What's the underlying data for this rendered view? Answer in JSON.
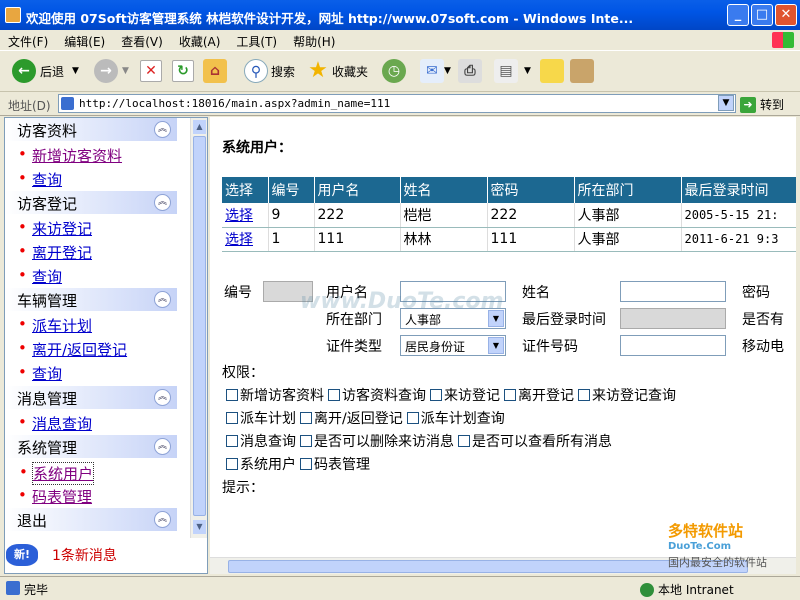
{
  "window": {
    "title": "欢迎使用 07Soft访客管理系统   林桤软件设计开发，网址 http://www.07soft.com - Windows Inte..."
  },
  "menu": [
    "文件(F)",
    "编辑(E)",
    "查看(V)",
    "收藏(A)",
    "工具(T)",
    "帮助(H)"
  ],
  "toolbar": {
    "back": "后退",
    "search": "搜索",
    "favorites": "收藏夹"
  },
  "address": {
    "label": "地址(D)",
    "url": "http://localhost:18016/main.aspx?admin_name=111",
    "go": "转到"
  },
  "sidebar": {
    "groups": [
      {
        "title": "访客资料",
        "items": [
          "新增访客资料",
          "查询"
        ]
      },
      {
        "title": "访客登记",
        "items": [
          "来访登记",
          "离开登记",
          "查询"
        ]
      },
      {
        "title": "车辆管理",
        "items": [
          "派车计划",
          "离开/返回登记",
          "查询"
        ]
      },
      {
        "title": "消息管理",
        "items": [
          "消息查询"
        ]
      },
      {
        "title": "系统管理",
        "items": [
          "系统用户",
          "码表管理"
        ]
      },
      {
        "title": "退出",
        "items": []
      }
    ],
    "new_message_badge": "新!",
    "new_message": "1条新消息"
  },
  "main": {
    "title": "系统用户：",
    "table": {
      "headers": [
        "选择",
        "编号",
        "用户名",
        "姓名",
        "密码",
        "所在部门",
        "最后登录时间"
      ],
      "rows": [
        [
          "选择",
          "9",
          "222",
          "桤桤",
          "222",
          "人事部",
          "2005-5-15 21:"
        ],
        [
          "选择",
          "1",
          "111",
          "林林",
          "111",
          "人事部",
          "2011-6-21 9:3"
        ]
      ]
    },
    "form": {
      "id_label": "编号",
      "username_label": "用户名",
      "name_label": "姓名",
      "password_label": "密码",
      "dept_label": "所在部门",
      "dept_value": "人事部",
      "last_login_label": "最后登录时间",
      "can_label": "是否有",
      "idtype_label": "证件类型",
      "idtype_value": "居民身份证",
      "idno_label": "证件号码",
      "mobile_label": "移动电"
    },
    "permissions_label": "权限：",
    "permissions": [
      [
        "新增访客资料",
        "访客资料查询",
        "来访登记",
        "离开登记",
        "来访登记查询"
      ],
      [
        "派车计划",
        "离开/返回登记",
        "派车计划查询"
      ],
      [
        "消息查询",
        "是否可以删除来访消息",
        "是否可以查看所有消息"
      ],
      [
        "系统用户",
        "码表管理"
      ]
    ],
    "hint_label": "提示："
  },
  "status": {
    "text": "完毕",
    "zone": "本地 Intranet"
  },
  "overlay": {
    "watermark": "www.DuoTe.com",
    "logo": "多特软件站",
    "logo_sub": "DuoTe.Com",
    "logo_caption": "国内最安全的软件站"
  }
}
